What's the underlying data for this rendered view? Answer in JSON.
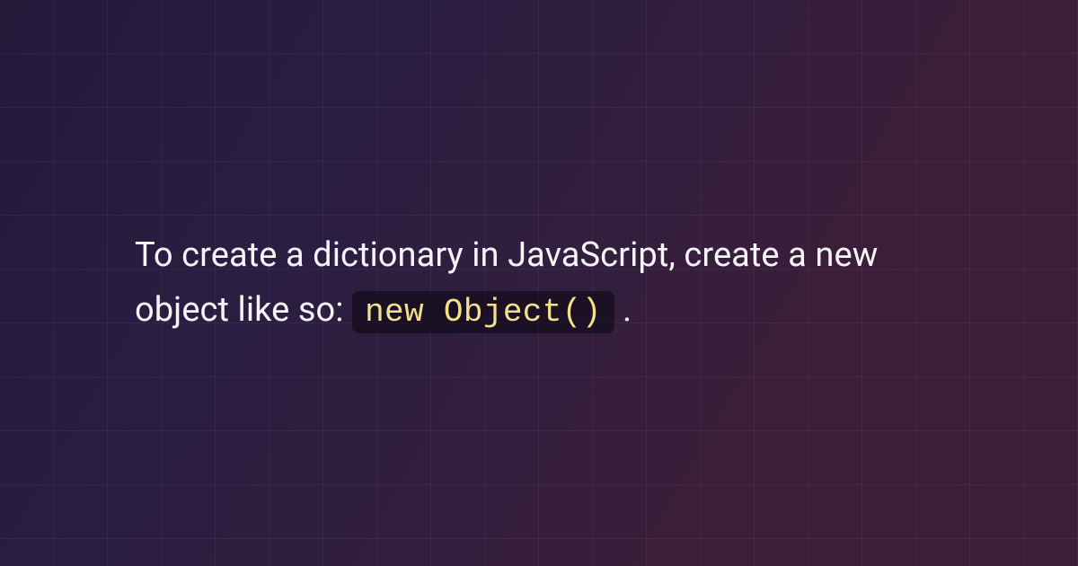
{
  "card": {
    "text_before": "To create a dictionary in JavaScript, create a new object like so: ",
    "code": "new Object()",
    "text_after": "."
  }
}
